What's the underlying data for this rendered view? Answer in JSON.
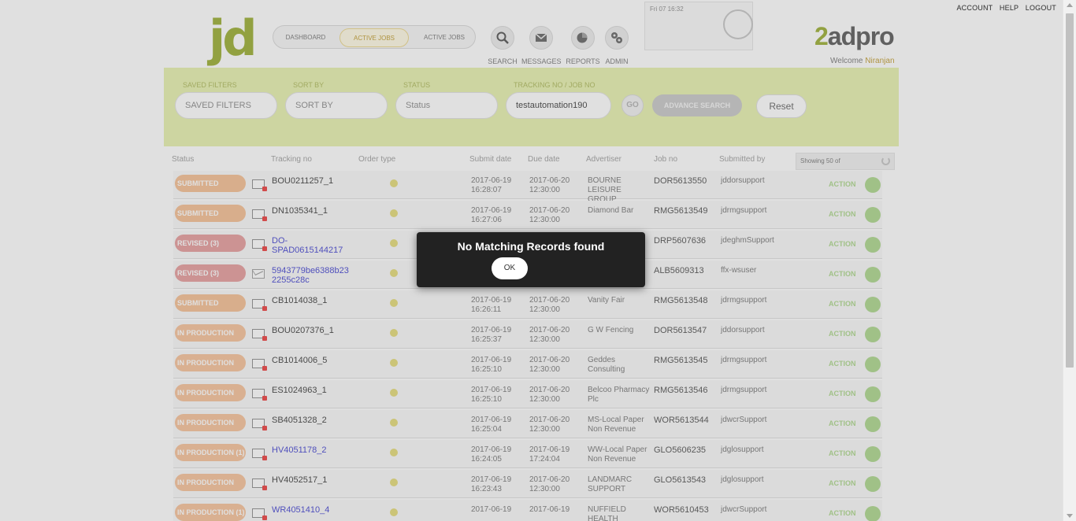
{
  "header": {
    "links": [
      "ACCOUNT",
      "HELP",
      "LOGOUT"
    ],
    "logo_left": "jd",
    "logo_right_prefix": "2",
    "logo_right_suffix": "adpro",
    "nav": [
      "DASHBOARD",
      "ACTIVE JOBS",
      "ACTIVE JOBS"
    ],
    "icons": [
      {
        "name": "search-icon",
        "caption": "SEARCH"
      },
      {
        "name": "envelope-icon",
        "caption": "MESSAGES"
      },
      {
        "name": "chart-icon",
        "caption": "REPORTS"
      },
      {
        "name": "gears-icon",
        "caption": "ADMIN"
      }
    ],
    "time_text": "Fri 07 16:32",
    "welcome_label": "Welcome",
    "welcome_user": "Niranjan"
  },
  "filters": {
    "saved_filters_label": "SAVED FILTERS",
    "saved_filters_value": "SAVED FILTERS",
    "sort_by_label": "SORT BY",
    "sort_by_value": "SORT BY",
    "status_label": "STATUS",
    "status_value": "Status",
    "tracking_label": "TRACKING NO / JOB NO",
    "tracking_value": "testautomation190",
    "go_label": "GO",
    "advanced_label": "ADVANCE SEARCH",
    "reset_label": "Reset"
  },
  "table": {
    "headers": [
      "Status",
      "Tracking no",
      "Order type",
      "Submit date",
      "Due date",
      "Advertiser",
      "Job no",
      "Submitted by"
    ],
    "showing": "Showing 50 of",
    "action_label": "ACTION",
    "rows": [
      {
        "status": "SUBMITTED",
        "kind": "sub",
        "tracking": "BOU0211257_1",
        "link": false,
        "submit": "2017-06-19 16:28:07",
        "due": "2017-06-20 12:30:00",
        "adv": "BOURNE LEISURE GROUP",
        "job": "DOR5613550",
        "by": "jddorsupport"
      },
      {
        "status": "SUBMITTED",
        "kind": "sub",
        "tracking": "DN1035341_1",
        "link": false,
        "submit": "2017-06-19 16:27:06",
        "due": "2017-06-20 12:30:00",
        "adv": "Diamond Bar",
        "job": "RMG5613549",
        "by": "jdrmgsupport"
      },
      {
        "status": "REVISED (3)",
        "kind": "rev",
        "tracking": "DO-SPAD0615144217",
        "link": true,
        "submit": "",
        "due": "",
        "adv": "",
        "job": "DRP5607636",
        "by": "jdeghmSupport"
      },
      {
        "status": "REVISED (3)",
        "kind": "rev",
        "tracking": "5943779be6388b23 2255c28c",
        "link": true,
        "submit": "",
        "due": "",
        "adv": "",
        "job": "ALB5609313",
        "by": "ffx-wsuser"
      },
      {
        "status": "SUBMITTED",
        "kind": "sub",
        "tracking": "CB1014038_1",
        "link": false,
        "submit": "2017-06-19 16:26:11",
        "due": "2017-06-20 12:30:00",
        "adv": "Vanity Fair",
        "job": "RMG5613548",
        "by": "jdrmgsupport"
      },
      {
        "status": "IN PRODUCTION",
        "kind": "prod",
        "tracking": "BOU0207376_1",
        "link": false,
        "submit": "2017-06-19 16:25:37",
        "due": "2017-06-20 12:30:00",
        "adv": "G W Fencing",
        "job": "DOR5613547",
        "by": "jddorsupport"
      },
      {
        "status": "IN PRODUCTION",
        "kind": "prod",
        "tracking": "CB1014006_5",
        "link": false,
        "submit": "2017-06-19 16:25:10",
        "due": "2017-06-20 12:30:00",
        "adv": "Geddes Consulting",
        "job": "RMG5613545",
        "by": "jdrmgsupport"
      },
      {
        "status": "IN PRODUCTION",
        "kind": "prod",
        "tracking": "ES1024963_1",
        "link": false,
        "submit": "2017-06-19 16:25:10",
        "due": "2017-06-20 12:30:00",
        "adv": "Belcoo Pharmacy Plc",
        "job": "RMG5613546",
        "by": "jdrmgsupport"
      },
      {
        "status": "IN PRODUCTION",
        "kind": "prod",
        "tracking": "SB4051328_2",
        "link": false,
        "submit": "2017-06-19 16:25:04",
        "due": "2017-06-20 12:30:00",
        "adv": "MS-Local Paper Non Revenue",
        "job": "WOR5613544",
        "by": "jdwcrSupport"
      },
      {
        "status": "IN PRODUCTION (1)",
        "kind": "prod",
        "tracking": "HV4051178_2",
        "link": true,
        "submit": "2017-06-19 16:24:05",
        "due": "2017-06-19 17:24:04",
        "adv": "WW-Local Paper Non Revenue",
        "job": "GLO5606235",
        "by": "jdglosupport"
      },
      {
        "status": "IN PRODUCTION",
        "kind": "prod",
        "tracking": "HV4052517_1",
        "link": false,
        "submit": "2017-06-19 16:23:43",
        "due": "2017-06-20 12:30:00",
        "adv": "LANDMARC SUPPORT",
        "job": "GLO5613543",
        "by": "jdglosupport"
      },
      {
        "status": "IN PRODUCTION (1)",
        "kind": "prod",
        "tracking": "WR4051410_4",
        "link": true,
        "submit": "2017-06-19",
        "due": "2017-06-19",
        "adv": "NUFFIELD HEALTH",
        "job": "WOR5610453",
        "by": "jdwcrSupport"
      }
    ]
  },
  "modal": {
    "message": "No Matching Records found",
    "ok_label": "OK"
  }
}
